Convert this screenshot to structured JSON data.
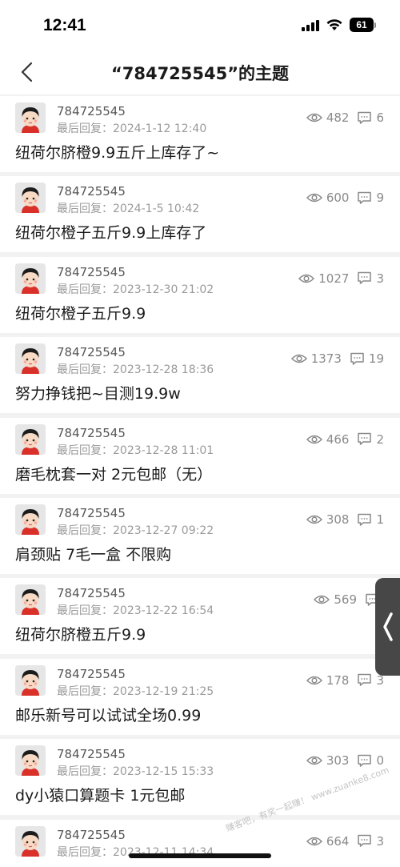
{
  "status_bar": {
    "time": "12:41",
    "battery": "61"
  },
  "header": {
    "title": "“784725545”的主题",
    "back_icon": "chevron-left-icon"
  },
  "posts": [
    {
      "username": "784725545",
      "last_reply": "最后回复：2024-1-12 12:40",
      "views": "482",
      "replies": "6",
      "title": "纽荷尔脐橙9.9五斤上库存了~"
    },
    {
      "username": "784725545",
      "last_reply": "最后回复：2024-1-5 10:42",
      "views": "600",
      "replies": "9",
      "title": "纽荷尔橙子五斤9.9上库存了"
    },
    {
      "username": "784725545",
      "last_reply": "最后回复：2023-12-30 21:02",
      "views": "1027",
      "replies": "3",
      "title": "纽荷尔橙子五斤9.9"
    },
    {
      "username": "784725545",
      "last_reply": "最后回复：2023-12-28 18:36",
      "views": "1373",
      "replies": "19",
      "title": "努力挣钱把~目测19.9w"
    },
    {
      "username": "784725545",
      "last_reply": "最后回复：2023-12-28 11:01",
      "views": "466",
      "replies": "2",
      "title": "磨毛枕套一对 2元包邮（无）"
    },
    {
      "username": "784725545",
      "last_reply": "最后回复：2023-12-27 09:22",
      "views": "308",
      "replies": "1",
      "title": "肩颈贴 7毛一盒 不限购"
    },
    {
      "username": "784725545",
      "last_reply": "最后回复：2023-12-22 16:54",
      "views": "569",
      "replies": "",
      "title": "纽荷尔脐橙五斤9.9"
    },
    {
      "username": "784725545",
      "last_reply": "最后回复：2023-12-19 21:25",
      "views": "178",
      "replies": "3",
      "title": "邮乐新号可以试试全场0.99"
    },
    {
      "username": "784725545",
      "last_reply": "最后回复：2023-12-15 15:33",
      "views": "303",
      "replies": "0",
      "title": "dy小猿口算题卡 1元包邮"
    },
    {
      "username": "784725545",
      "last_reply": "最后回复：2023-12-11 14:34",
      "views": "664",
      "replies": "3",
      "title": ""
    }
  ],
  "watermark": "赚客吧，有奖一起赚！ www.zuanke8.com",
  "colors": {
    "background": "#f2f2f2",
    "card": "#ffffff",
    "text": "#1a1a1a",
    "secondary": "#9a9a9a",
    "avatar_shirt": "#d9302a"
  }
}
